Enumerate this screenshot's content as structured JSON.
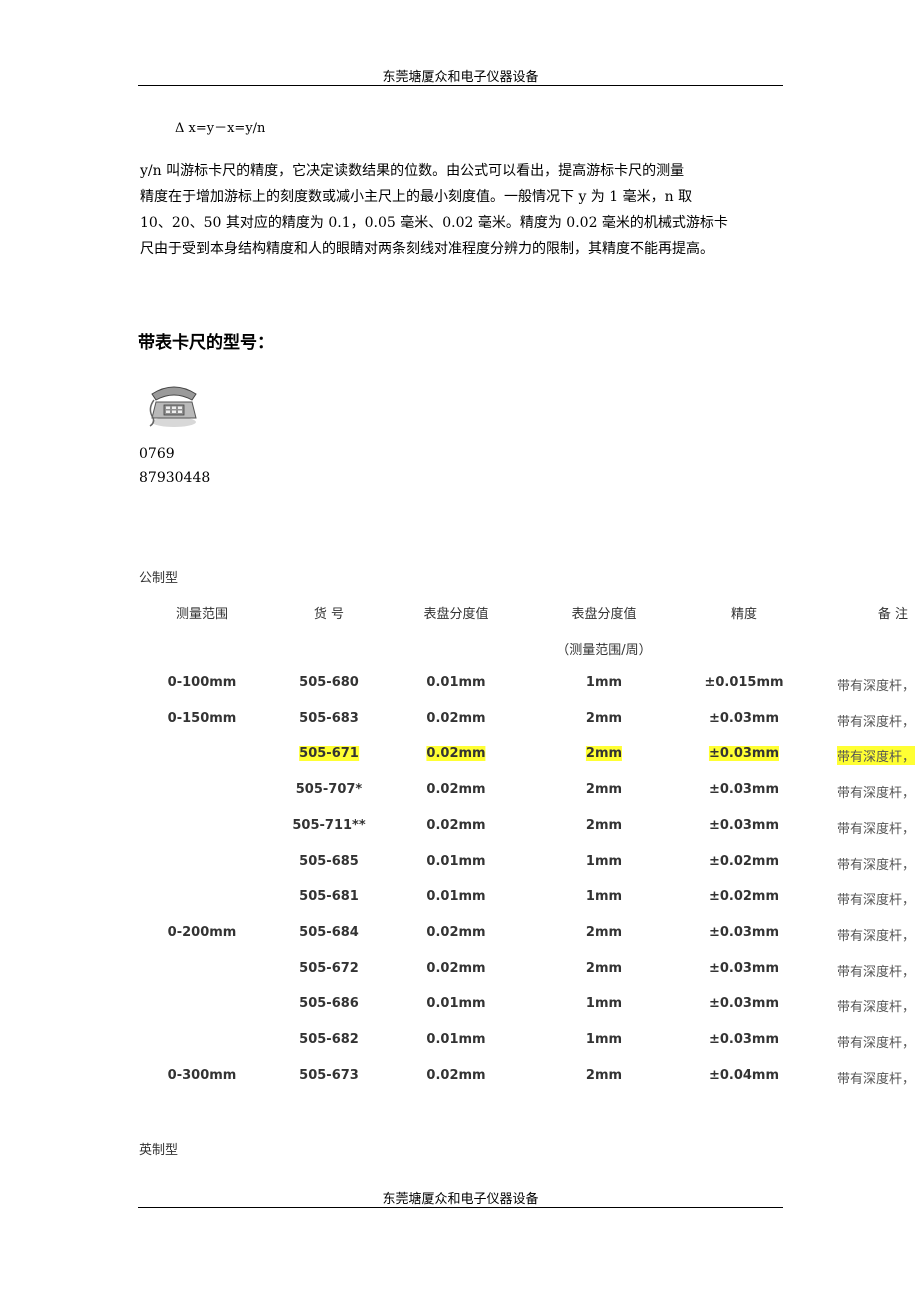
{
  "header": {
    "company": "东莞塘厦众和电子仪器设备"
  },
  "footer": {
    "company": "东莞塘厦众和电子仪器设备"
  },
  "formula": "Δ x=y－x=y/n",
  "paragraph_lines": [
    "y/n 叫游标卡尺的精度，它决定读数结果的位数。由公式可以看出，提高游标卡尺的测量",
    "精度在于增加游标上的刻度数或减小主尺上的最小刻度值。一般情况下 y 为 1 毫米，n 取",
    "10、20、50 其对应的精度为 0.1，0.05 毫米、0.02 毫米。精度为 0.02 毫米的机械式游标卡",
    "尺由于受到本身结构精度和人的眼睛对两条刻线对准程度分辨力的限制，其精度不能再提高。"
  ],
  "section_heading": "带表卡尺的型号：",
  "phone_icon": "telephone-icon",
  "phone_lines": [
    "0769",
    "87930448"
  ],
  "metric_label": "公制型",
  "imperial_label": "英制型",
  "table": {
    "headers": [
      "测量范围",
      "货 号",
      "表盘分度值",
      "表盘分度值",
      "精度",
      "备 注"
    ],
    "subheader": "（测量范围/周）",
    "highlight_color": "#ffff33",
    "rows": [
      {
        "range": "0-100mm",
        "code": "505-680",
        "div": "0.01mm",
        "per_rev": "1mm",
        "acc": "±0.015mm",
        "note": "带有深度杆，",
        "highlight": false
      },
      {
        "range": "0-150mm",
        "code": "505-683",
        "div": "0.02mm",
        "per_rev": "2mm",
        "acc": "±0.03mm",
        "note": "带有深度杆，",
        "highlight": false
      },
      {
        "range": "",
        "code": "505-671",
        "div": "0.02mm",
        "per_rev": "2mm",
        "acc": "±0.03mm",
        "note": "带有深度杆，",
        "highlight": true
      },
      {
        "range": "",
        "code": "505-707*",
        "div": "0.02mm",
        "per_rev": "2mm",
        "acc": "±0.03mm",
        "note": "带有深度杆，",
        "highlight": false
      },
      {
        "range": "",
        "code": "505-711**",
        "div": "0.02mm",
        "per_rev": "2mm",
        "acc": "±0.03mm",
        "note": "带有深度杆，",
        "highlight": false
      },
      {
        "range": "",
        "code": "505-685",
        "div": "0.01mm",
        "per_rev": "1mm",
        "acc": "±0.02mm",
        "note": "带有深度杆，",
        "highlight": false
      },
      {
        "range": "",
        "code": "505-681",
        "div": "0.01mm",
        "per_rev": "1mm",
        "acc": "±0.02mm",
        "note": "带有深度杆，",
        "highlight": false
      },
      {
        "range": "0-200mm",
        "code": "505-684",
        "div": "0.02mm",
        "per_rev": "2mm",
        "acc": "±0.03mm",
        "note": "带有深度杆，",
        "highlight": false
      },
      {
        "range": "",
        "code": "505-672",
        "div": "0.02mm",
        "per_rev": "2mm",
        "acc": "±0.03mm",
        "note": "带有深度杆，",
        "highlight": false
      },
      {
        "range": "",
        "code": "505-686",
        "div": "0.01mm",
        "per_rev": "1mm",
        "acc": "±0.03mm",
        "note": "带有深度杆，",
        "highlight": false
      },
      {
        "range": "",
        "code": "505-682",
        "div": "0.01mm",
        "per_rev": "1mm",
        "acc": "±0.03mm",
        "note": "带有深度杆，",
        "highlight": false
      },
      {
        "range": "0-300mm",
        "code": "505-673",
        "div": "0.02mm",
        "per_rev": "2mm",
        "acc": "±0.04mm",
        "note": "带有深度杆，",
        "highlight": false
      }
    ]
  }
}
